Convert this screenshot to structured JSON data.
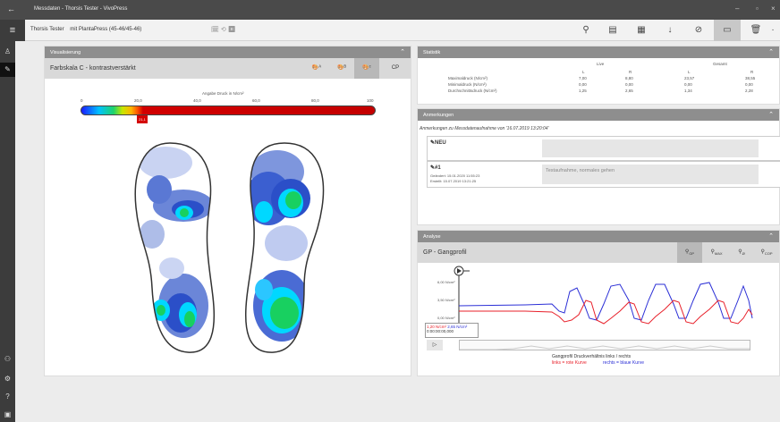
{
  "titlebar": {
    "title": "Messdaten - Thorsis Tester - VivoPress",
    "back": "←",
    "min": "–",
    "max": "▫",
    "close": "×"
  },
  "toolbar": {
    "patient": "Thorsis Tester",
    "device": "mit PlantaPress (45-46/45-46)",
    "mid_icons": "🗓  ⟲  ⏸"
  },
  "visualisierung": {
    "header": "Visualisierung",
    "scale_label": "Farbskala C - kontrastverstärkt",
    "cp": "CP",
    "scale_title": "Angabe Druck in N/cm²",
    "ticks": [
      "0",
      "20,0",
      "40,0",
      "60,0",
      "80,0",
      "100"
    ],
    "marker": "21,1"
  },
  "statistik": {
    "header": "Statistik",
    "live": "Live",
    "gesamt": "Gesamt",
    "col_labels": [
      "L",
      "R",
      "L",
      "R"
    ],
    "rows": [
      {
        "label": "Maximaldruck (N/cm²)",
        "values": [
          "7,00",
          "8,80",
          "23,57",
          "38,55"
        ]
      },
      {
        "label": "Minimaldruck (N/cm²)",
        "values": [
          "0,00",
          "0,00",
          "0,00",
          "0,00"
        ]
      },
      {
        "label": "Durchschnittsdruck (N/cm²)",
        "values": [
          "1,25",
          "2,65",
          "1,34",
          "2,28"
        ]
      }
    ]
  },
  "anmerkungen": {
    "header": "Anmerkungen",
    "subtitle": "Anmerkungen zu Messdatenaufnahme von '16.07.2019 13:20:04'",
    "new_label": "NEU",
    "note1_label": "#1",
    "note1_changed": "Geändert: 15.01.2020 11:55:23",
    "note1_created": "Erstellt: 15.07.2019 13:21:25",
    "note1_text": "Testaufnahme, normales gehen"
  },
  "analyse": {
    "header": "Analyse",
    "title": "GP - Gangprofil",
    "icons": [
      "GP",
      "MAX",
      "Ø",
      "COP"
    ],
    "y_labels": [
      "6,00 N/cm²",
      "3,50 N/cm²",
      "0,00 N/cm²"
    ],
    "readout_red": "1,20 N/cm²",
    "readout_blue": "2,65 N/cm²",
    "readout_time": "0:00:00:00,000",
    "legend_title": "Gangprofil Druckverhältnis links / rechts",
    "legend_links": "links = rote Kurve",
    "legend_rechts": "rechts = blaue Kurve",
    "colors": {
      "left": "#e8202a",
      "right": "#2b2fd6"
    }
  }
}
